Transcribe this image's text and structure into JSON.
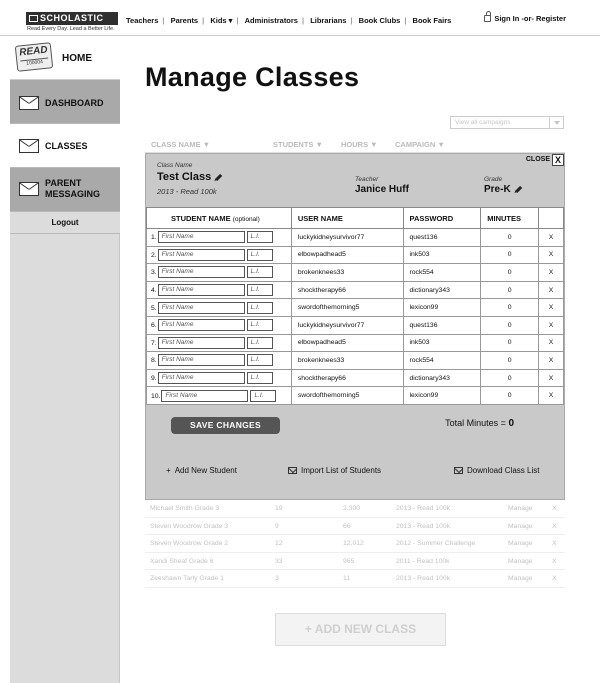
{
  "header": {
    "brand": "SCHOLASTIC",
    "tagline": "Read Every Day. Lead a Better Life.",
    "nav": [
      "Teachers",
      "Parents",
      "Kids",
      "Administrators",
      "Librarians",
      "Book Clubs",
      "Book Fairs"
    ],
    "kids_dropdown_glyph": "▾",
    "signin": "Sign In -or- Register"
  },
  "sidebar": {
    "read_logo_top": "READ",
    "read_logo_bottom": "100004",
    "home": "HOME",
    "dashboard": "DASHBOARD",
    "classes": "CLASSES",
    "parent_messaging_line1": "PARENT",
    "parent_messaging_line2": "MESSAGING",
    "logout": "Logout"
  },
  "page": {
    "title": "Manage Classes",
    "campaign_filter": "View all campaigns",
    "columns": [
      "CLASS NAME ▼",
      "STUDENTS ▼",
      "HOURS ▼",
      "CAMPAIGN ▼"
    ]
  },
  "panel": {
    "class_name_label": "Class Name",
    "class_name": "Test Class",
    "campaign": "2013 - Read 100k",
    "teacher_label": "Teacher",
    "teacher": "Janice Huff",
    "grade_label": "Grade",
    "grade": "Pre-K",
    "close": "CLOSE",
    "close_glyph": "X",
    "table_headers": {
      "student_name": "STUDENT NAME",
      "optional": "(optional)",
      "user_name": "USER NAME",
      "password": "PASSWORD",
      "minutes": "MINUTES"
    },
    "first_name_placeholder": "First Name",
    "li_placeholder": "L.I.",
    "remove_glyph": "X",
    "rows": [
      {
        "num": "1.",
        "user": "luckykidneysurvivor77",
        "password": "quest136",
        "minutes": "0"
      },
      {
        "num": "2.",
        "user": "elbowpadhead5",
        "password": "ink503",
        "minutes": "0"
      },
      {
        "num": "3.",
        "user": "brokenknees33",
        "password": "rock554",
        "minutes": "0"
      },
      {
        "num": "4.",
        "user": "shocktherapy66",
        "password": "dictionary343",
        "minutes": "0"
      },
      {
        "num": "5.",
        "user": "swordofthemorning5",
        "password": "lexicon99",
        "minutes": "0"
      },
      {
        "num": "6.",
        "user": "luckykidneysurvivor77",
        "password": "quest136",
        "minutes": "0"
      },
      {
        "num": "7.",
        "user": "elbowpadhead5",
        "password": "ink503",
        "minutes": "0"
      },
      {
        "num": "8.",
        "user": "brokenknees33",
        "password": "rock554",
        "minutes": "0"
      },
      {
        "num": "9.",
        "user": "shocktherapy66",
        "password": "dictionary343",
        "minutes": "0"
      },
      {
        "num": "10.",
        "user": "swordofthemorning5",
        "password": "lexicon99",
        "minutes": "0"
      }
    ],
    "save": "SAVE CHANGES",
    "total_label": "Total Minutes =",
    "total_value": "0",
    "add_student_glyph": "+",
    "add_student": "Add New Student",
    "import_list": "Import List of Students",
    "download_list": "Download Class List"
  },
  "other_classes": [
    {
      "name": "Michael Smith Grade 3",
      "students": "19",
      "hours": "2,300",
      "campaign": "2013 - Read 100k",
      "action": "Manage",
      "remove": "X"
    },
    {
      "name": "Steven Woodrow Grade 3",
      "students": "9",
      "hours": "66",
      "campaign": "2013 - Read 100k",
      "action": "Manage",
      "remove": "X"
    },
    {
      "name": "Steven Woodrow Grade 2",
      "students": "12",
      "hours": "12,012",
      "campaign": "2012 - Summer Challenge",
      "action": "Manage",
      "remove": "X"
    },
    {
      "name": "Xandi Sheaf Grade 6",
      "students": "33",
      "hours": "965",
      "campaign": "2011 - Read 100k",
      "action": "Manage",
      "remove": "X"
    },
    {
      "name": "Zeeshawn Tarly Grade 1",
      "students": "3",
      "hours": "11",
      "campaign": "2013 - Read 100k",
      "action": "Manage",
      "remove": "X"
    }
  ],
  "add_class": "+ ADD NEW CLASS"
}
